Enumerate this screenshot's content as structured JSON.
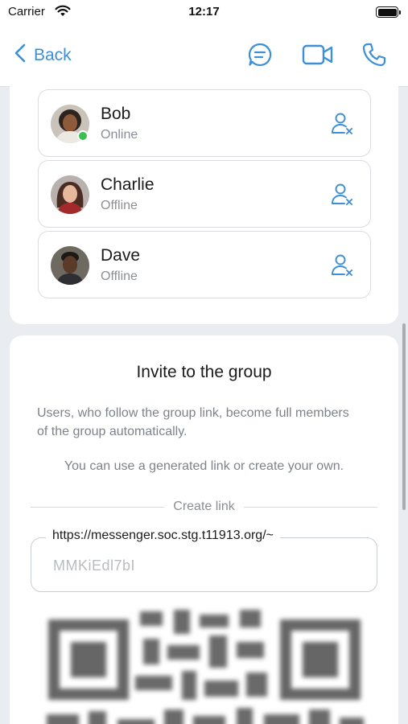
{
  "status_bar": {
    "carrier": "Carrier",
    "time": "12:17"
  },
  "nav": {
    "back_label": "Back",
    "accent_color": "#3d8fd8",
    "icons": [
      "chat-bubble-icon",
      "video-camera-icon",
      "phone-icon"
    ]
  },
  "members": [
    {
      "name": "Bob",
      "status": "Online",
      "online": true
    },
    {
      "name": "Charlie",
      "status": "Offline",
      "online": false
    },
    {
      "name": "Dave",
      "status": "Offline",
      "online": false
    }
  ],
  "invite": {
    "title": "Invite to the group",
    "description": "Users, who follow the group link, become full members of the group automatically.",
    "hint": "You can use a generated link or create your own.",
    "create_link_label": "Create link",
    "link_prefix": "https://messenger.soc.stg.t11913.org/~",
    "link_value": "MMKiEdl7bI"
  }
}
